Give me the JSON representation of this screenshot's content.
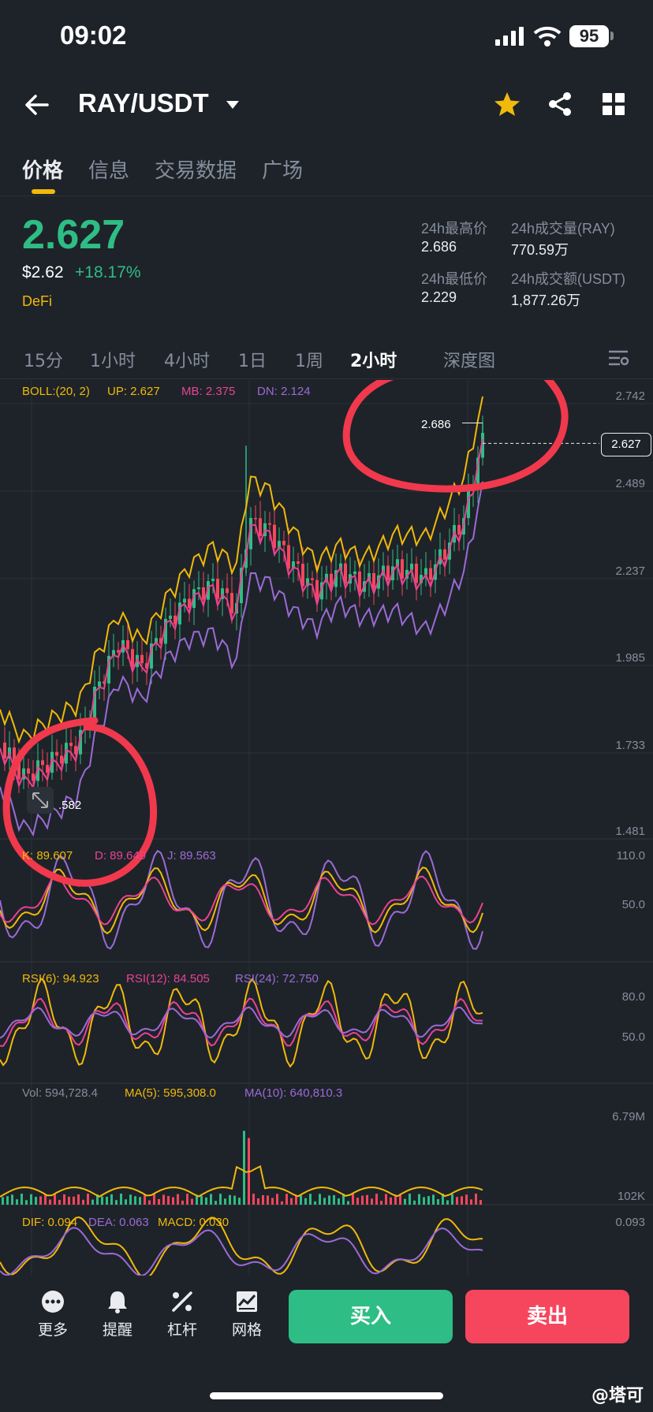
{
  "status": {
    "time": "09:02",
    "battery": "95"
  },
  "header": {
    "pair": "RAY/USDT"
  },
  "tabs": [
    "价格",
    "信息",
    "交易数据",
    "广场"
  ],
  "price": {
    "last": "2.627",
    "usd": "$2.62",
    "change": "+18.17%",
    "tag": "DeFi"
  },
  "stats": {
    "high_label": "24h最高价",
    "high": "2.686",
    "low_label": "24h最低价",
    "low": "2.229",
    "vol_label": "24h成交量(RAY)",
    "vol": "770.59万",
    "amt_label": "24h成交额(USDT)",
    "amt": "1,877.26万"
  },
  "intervals": [
    "15分",
    "1小时",
    "4小时",
    "1日",
    "1周",
    "2小时",
    "深度图"
  ],
  "boll": {
    "label": "BOLL:(20, 2)",
    "up": "UP: 2.627",
    "mb": "MB: 2.375",
    "dn": "DN: 2.124"
  },
  "price_axis": [
    "2.742",
    "2.489",
    "2.237",
    "1.985",
    "1.733",
    "1.481"
  ],
  "current_price_tag": "2.627",
  "high_marker": "2.686",
  "low_marker": ".582",
  "kdj": {
    "k": "K: 89.607",
    "d": "D: 89.649",
    "j": "J: 89.563",
    "axis": [
      "110.0",
      "50.0"
    ]
  },
  "rsi": {
    "r6": "RSI(6): 94.923",
    "r12": "RSI(12): 84.505",
    "r24": "RSI(24): 72.750",
    "axis": [
      "80.0",
      "50.0"
    ]
  },
  "vol": {
    "vol": "Vol: 594,728.4",
    "ma5": "MA(5): 595,308.0",
    "ma10": "MA(10): 640,810.3",
    "axis": [
      "6.79M",
      "102K"
    ]
  },
  "macd": {
    "dif": "DIF: 0.094",
    "dea": "DEA: 0.063",
    "macd": "MACD: 0.030",
    "axis": [
      "0.093"
    ]
  },
  "bottom": {
    "more": "更多",
    "alert": "提醒",
    "lever": "杠杆",
    "grid": "网格",
    "buy": "买入",
    "sell": "卖出"
  },
  "watermark": "@塔可",
  "colors": {
    "up": "#2ebd85",
    "down": "#f6465d",
    "accent": "#f0b90b",
    "boll_up": "#f0b90b",
    "boll_mb": "#e84393",
    "boll_dn": "#9b6bd6",
    "annotation": "#f0394d"
  }
}
